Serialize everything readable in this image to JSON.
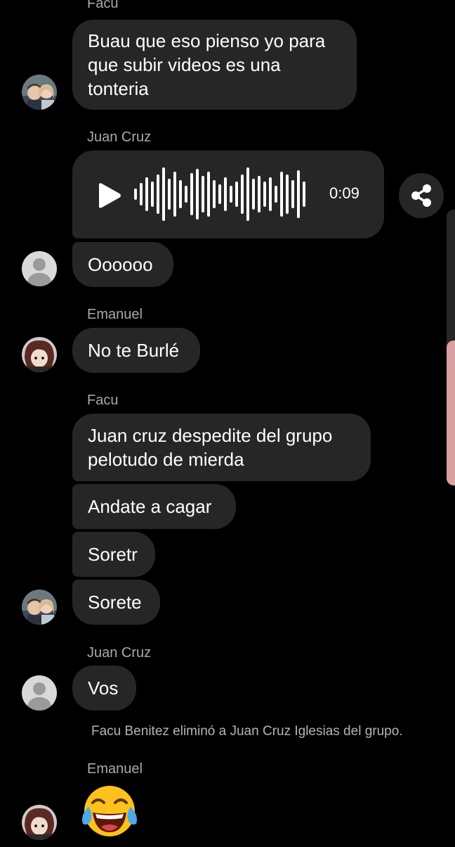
{
  "messages": [
    {
      "sender": "Facu",
      "text": "Buau que eso pienso yo para\nque subir videos es una\ntonteria"
    },
    {
      "sender": "Juan Cruz",
      "voice_duration": "0:09"
    },
    {
      "text": "Oooooo"
    },
    {
      "sender": "Emanuel",
      "text": "No te Burlé"
    },
    {
      "sender": "Facu",
      "text": "Juan cruz despedite del grupo\npelotudo de mierda"
    },
    {
      "text": "Andate a cagar"
    },
    {
      "text": "Soretr"
    },
    {
      "text": "Sorete"
    },
    {
      "sender": "Juan Cruz",
      "text": "Vos"
    },
    {
      "system": "Facu Benitez eliminó a Juan Cruz Iglesias del grupo."
    },
    {
      "sender": "Emanuel",
      "emoji": "tears-of-joy-emoji"
    }
  ],
  "colors": {
    "background": "#000000",
    "bubble": "#262626",
    "sender_name": "#a9a9a9",
    "system_text": "#b4b4b4",
    "side_edge": "#d8a0a0"
  },
  "icons": {
    "play": "play-icon",
    "share": "share-icon",
    "waveform": "waveform-icon"
  }
}
